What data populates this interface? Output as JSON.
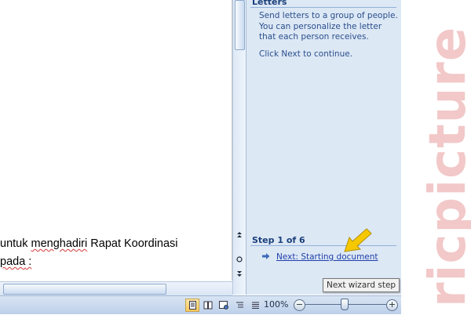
{
  "document": {
    "line1_plain": "untuk ",
    "line1_squiggle": "menghadiri",
    "line1_rest": " Rapat Koordinasi",
    "line2_squiggle": "pada",
    "line2_rest": " :"
  },
  "task_pane": {
    "title": "Letters",
    "description_lines": [
      "Send letters to a group of people.",
      "You can personalize the letter",
      "that each person receives."
    ],
    "click_next": "Click Next to continue.",
    "step_label": "Step 1 of 6",
    "next_link": "Next: Starting document"
  },
  "tooltip": "Next wizard step",
  "status_bar": {
    "zoom_percent": "100%",
    "zoom_out_symbol": "−",
    "zoom_in_symbol": "+",
    "views": [
      "print-layout",
      "full-screen-reading",
      "web-layout",
      "outline",
      "draft"
    ],
    "active_view": "print-layout"
  },
  "watermark": "ricpicture",
  "colors": {
    "pane_bg": "#dde8f5",
    "pane_text": "#2a4f8c",
    "link": "#1f3fa8",
    "watermark": "#f2c8c8",
    "highlight_arrow": "#f5c800"
  }
}
